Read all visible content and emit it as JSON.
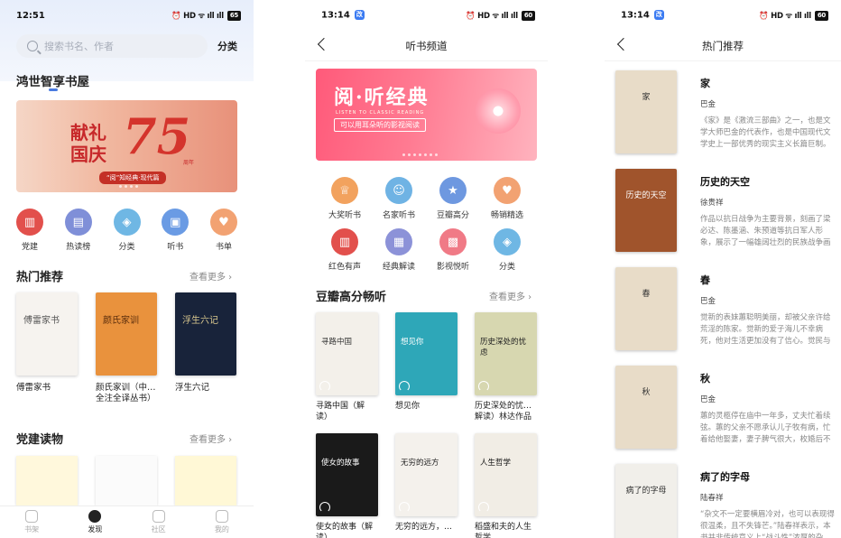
{
  "screen1": {
    "status": {
      "time": "12:51",
      "icons": "⏰ HD ᯤ ıll ıll",
      "battery": "65"
    },
    "search": {
      "placeholder": "搜索书名、作者",
      "classify": "分类"
    },
    "shelf_title": "鸿世智享书屋",
    "banner": {
      "title": "献礼国庆",
      "number": "75",
      "year": "周年",
      "subtitle": "“阅”知经典·现代篇"
    },
    "categories": [
      {
        "label": "党建",
        "color": "#e2504c",
        "icon": "bank-icon",
        "glyph": "▥"
      },
      {
        "label": "热读榜",
        "color": "#7f8fd8",
        "icon": "chart-icon",
        "glyph": "▤"
      },
      {
        "label": "分类",
        "color": "#6fb7e4",
        "icon": "layers-icon",
        "glyph": "◈"
      },
      {
        "label": "听书",
        "color": "#6a9be4",
        "icon": "headphone-book-icon",
        "glyph": "▣"
      },
      {
        "label": "书单",
        "color": "#f2a272",
        "icon": "book-list-icon",
        "glyph": "♥"
      }
    ],
    "hot": {
      "title": "热门推荐",
      "more": "查看更多 ›",
      "books": [
        {
          "name": "傅雷家书",
          "cover_title": "傅雷家书",
          "cover_color": "#f6f3ef",
          "cover_text_color": "#555"
        },
        {
          "name": "颜氏家训（中…\n全注全译丛书）",
          "cover_title": "颜氏家训",
          "cover_color": "#e9923d",
          "cover_text_color": "#5a2d0c"
        },
        {
          "name": "浮生六记",
          "cover_title": "浮生六记",
          "cover_color": "#18233a",
          "cover_text_color": "#d9c78e"
        }
      ]
    },
    "party": {
      "title": "党建读物",
      "more": "查看更多 ›"
    },
    "nav": [
      {
        "label": "书架",
        "active": false
      },
      {
        "label": "发现",
        "active": true
      },
      {
        "label": "社区",
        "active": false
      },
      {
        "label": "我的",
        "active": false
      }
    ]
  },
  "screen2": {
    "status": {
      "time": "13:14",
      "app_badge": "改",
      "icons": "⏰ HD ᯤ ıll ıll",
      "battery": "60"
    },
    "header": "听书频道",
    "banner": {
      "title": "阅·听经典",
      "en": "LISTEN TO CLASSIC READING",
      "subtitle": "可以用耳朵听的影视阅读"
    },
    "grid": [
      {
        "label": "大奖听书",
        "color": "#f2a25e",
        "icon": "trophy-icon",
        "glyph": "♕"
      },
      {
        "label": "名家听书",
        "color": "#6fb3e4",
        "icon": "person-icon",
        "glyph": "☺"
      },
      {
        "label": "豆瓣高分",
        "color": "#6e98e0",
        "icon": "star-book-icon",
        "glyph": "★"
      },
      {
        "label": "畅销精选",
        "color": "#f2a272",
        "icon": "heart-book-icon",
        "glyph": "♥"
      },
      {
        "label": "红色有声",
        "color": "#e2504c",
        "icon": "bank-icon",
        "glyph": "▥"
      },
      {
        "label": "经典解读",
        "color": "#8c92d8",
        "icon": "book-icon",
        "glyph": "▦"
      },
      {
        "label": "影视悦听",
        "color": "#f07a86",
        "icon": "film-icon",
        "glyph": "▩"
      },
      {
        "label": "分类",
        "color": "#6fb7e4",
        "icon": "layers-icon",
        "glyph": "◈"
      }
    ],
    "douban": {
      "title": "豆瓣高分畅听",
      "more": "查看更多 ›",
      "books": [
        {
          "name": "寻路中国（解\n读）",
          "cover_title": "寻路中国",
          "cover_color": "#f3f0ea",
          "cover_text_color": "#333"
        },
        {
          "name": "想见你",
          "cover_title": "想见你",
          "cover_color": "#2ea7b8",
          "cover_text_color": "#fff"
        },
        {
          "name": "历史深处的忧…\n解读）林达作品",
          "cover_title": "历史深处的忧虑",
          "cover_color": "#d7d7b0",
          "cover_text_color": "#222"
        },
        {
          "name": "使女的故事（解\n读）",
          "cover_title": "使女的故事",
          "cover_color": "#1a1a1a",
          "cover_text_color": "#fff"
        },
        {
          "name": "无穷的远方，…",
          "cover_title": "无穷的远方",
          "cover_color": "#f4f1ec",
          "cover_text_color": "#222"
        },
        {
          "name": "稻盛和夫的人生\n哲学",
          "cover_title": "人生哲学",
          "cover_color": "#f1ede5",
          "cover_text_color": "#111"
        }
      ]
    }
  },
  "screen3": {
    "status": {
      "time": "13:14",
      "app_badge": "改",
      "icons": "⏰ HD ᯤ ıll ıll",
      "battery": "60"
    },
    "header": "热门推荐",
    "books": [
      {
        "title": "家",
        "author": "巴金",
        "desc": "《家》是《激流三部曲》之一，也是文学大师巴金的代表作，也是中国现代文学史上一部优秀的现实主义长篇巨制。小说以…",
        "cover_title": "家",
        "cover_color": "#e8dcc8"
      },
      {
        "title": "历史的天空",
        "author": "徐贵祥",
        "desc": "作品以抗日战争为主要背景，刻画了梁必达、陈墨涵、朱预道等抗日军人形象，展示了一幅雄阔壮烈的民族战争画卷。多…",
        "cover_title": "历史的天空",
        "cover_color": "#a0542c"
      },
      {
        "title": "春",
        "author": "巴金",
        "desc": "觉新的表妹蕙聪明美丽，却被父亲许给荒淫的陈家。觉新的爱子海儿不幸病死，他对生活更加没有了信心。觉民与琴积…",
        "cover_title": "春",
        "cover_color": "#e8dcc8"
      },
      {
        "title": "秋",
        "author": "巴金",
        "desc": "蕙的灵柩停在庙中一年多，丈夫忙着续弦。蕙的父亲不愿承认儿子牧有病，忙着给他娶妻，妻子脾气很大，枚婚后不久…",
        "cover_title": "秋",
        "cover_color": "#e8dcc8"
      },
      {
        "title": "病了的字母",
        "author": "陆春祥",
        "desc": "“杂文不一定要横眉冷对，也可以表现得很温柔，且不失锋芒。”陆春祥表示，本书并非传统意义上“战斗性”浓厚的杂文…",
        "cover_title": "病了的字母",
        "cover_color": "#f1efea"
      }
    ]
  }
}
